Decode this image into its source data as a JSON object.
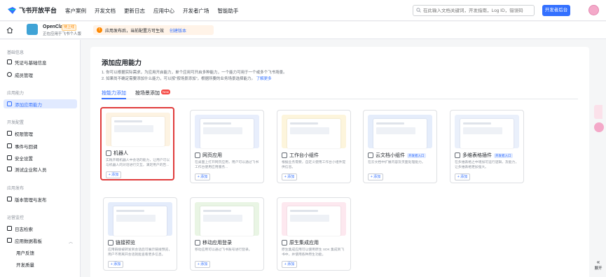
{
  "topbar": {
    "logo_text": "飞书开放平台",
    "nav": [
      "客户案例",
      "开发文档",
      "更新日志",
      "应用中心",
      "开发者广场",
      "智能助手"
    ],
    "search_placeholder": "在此输入文档关键词，开发指南，Log ID，错误码",
    "dev_button": "开发者后台",
    "accent": "#3370ff"
  },
  "app": {
    "name": "OpenClaw",
    "badge": "待上线",
    "subtitle": "正在应用于飞书个人版",
    "notice": "应用发布后，当前配置方可生效",
    "notice_link": "创建版本"
  },
  "sidebar": {
    "sections": [
      {
        "title": "基础信息",
        "items": [
          {
            "label": "凭证与基础信息"
          },
          {
            "label": "成员管理"
          }
        ]
      },
      {
        "title": "应用能力",
        "items": [
          {
            "label": "添加应用能力",
            "active": true
          }
        ]
      },
      {
        "title": "开发配置",
        "items": [
          {
            "label": "权限管理"
          },
          {
            "label": "事件与回调"
          },
          {
            "label": "安全设置"
          },
          {
            "label": "测试企业和人员"
          }
        ]
      },
      {
        "title": "应用发布",
        "items": [
          {
            "label": "版本管理与发布"
          }
        ]
      },
      {
        "title": "运营监控",
        "items": [
          {
            "label": "日志检索"
          },
          {
            "label": "应用数据看板",
            "expandable": true
          },
          {
            "label": "用户反馈",
            "sub": true
          },
          {
            "label": "开发质量",
            "sub": true
          }
        ]
      }
    ]
  },
  "main": {
    "title": "添加应用能力",
    "desc1": "1. 你可以根据实际需求，为应用开启能力，单个应用可开启多种能力，一个能力可用于一个或多个飞书场景。",
    "desc2": "2. 如果尚不确定需要添加什么能力，可以按\"按场景添加\"，根据所要的业务场景选择能力。",
    "desc2_link": "了解更多",
    "tabs": [
      "按能力添加",
      "按场景添加"
    ],
    "new_badge": "New",
    "cards": [
      {
        "title": "机器人",
        "desc": "实践开箱机器人中会话的能力，让用户可以与机器人的对话进行交互，满足用户的告...",
        "add": "+ 添加",
        "selected": true,
        "bg": "#fdf3e2"
      },
      {
        "title": "网页应用",
        "desc": "在桌面上打开网页应用，用户可以通过飞书工作台使用应用服务...",
        "add": "+ 添加",
        "bg": "#e8eefc"
      },
      {
        "title": "工作台小组件",
        "desc": "根据业务需要，自定义使用工作台小组件提供信息。",
        "add": "+ 添加",
        "bg": "#fdf5dc"
      },
      {
        "title": "云文档小组件",
        "desc": "在云文档中扩展内容及页面处理能力。",
        "add": "+ 添加",
        "badge": "开发者入口",
        "bg": "#e5edfb"
      },
      {
        "title": "多维表格插件",
        "desc": "在多维表格之中增加可运行逻辑，及能力，让多维表格更加强大。",
        "add": "+ 添加",
        "badge": "开发者入口",
        "bg": "#eaf0fb"
      },
      {
        "title": "链接预览",
        "desc": "应用链接被转发到会话后可展示链接预览，用户不用离开会话就能查看更多信息。",
        "add": "+ 添加",
        "bg": "#e4ecfb"
      },
      {
        "title": "移动应用登录",
        "desc": "移动应用可以通过飞书账号进行登录。",
        "add": "+ 添加",
        "bg": "#e9f5e4"
      },
      {
        "title": "原生集成应用",
        "desc": "原生集成应用可以使用原生 SDK 集成到飞书中，并使用各种原生功能。",
        "add": "+ 添加",
        "bg": "#fde8ef"
      }
    ]
  },
  "floating": {
    "expand_label": "展开"
  }
}
